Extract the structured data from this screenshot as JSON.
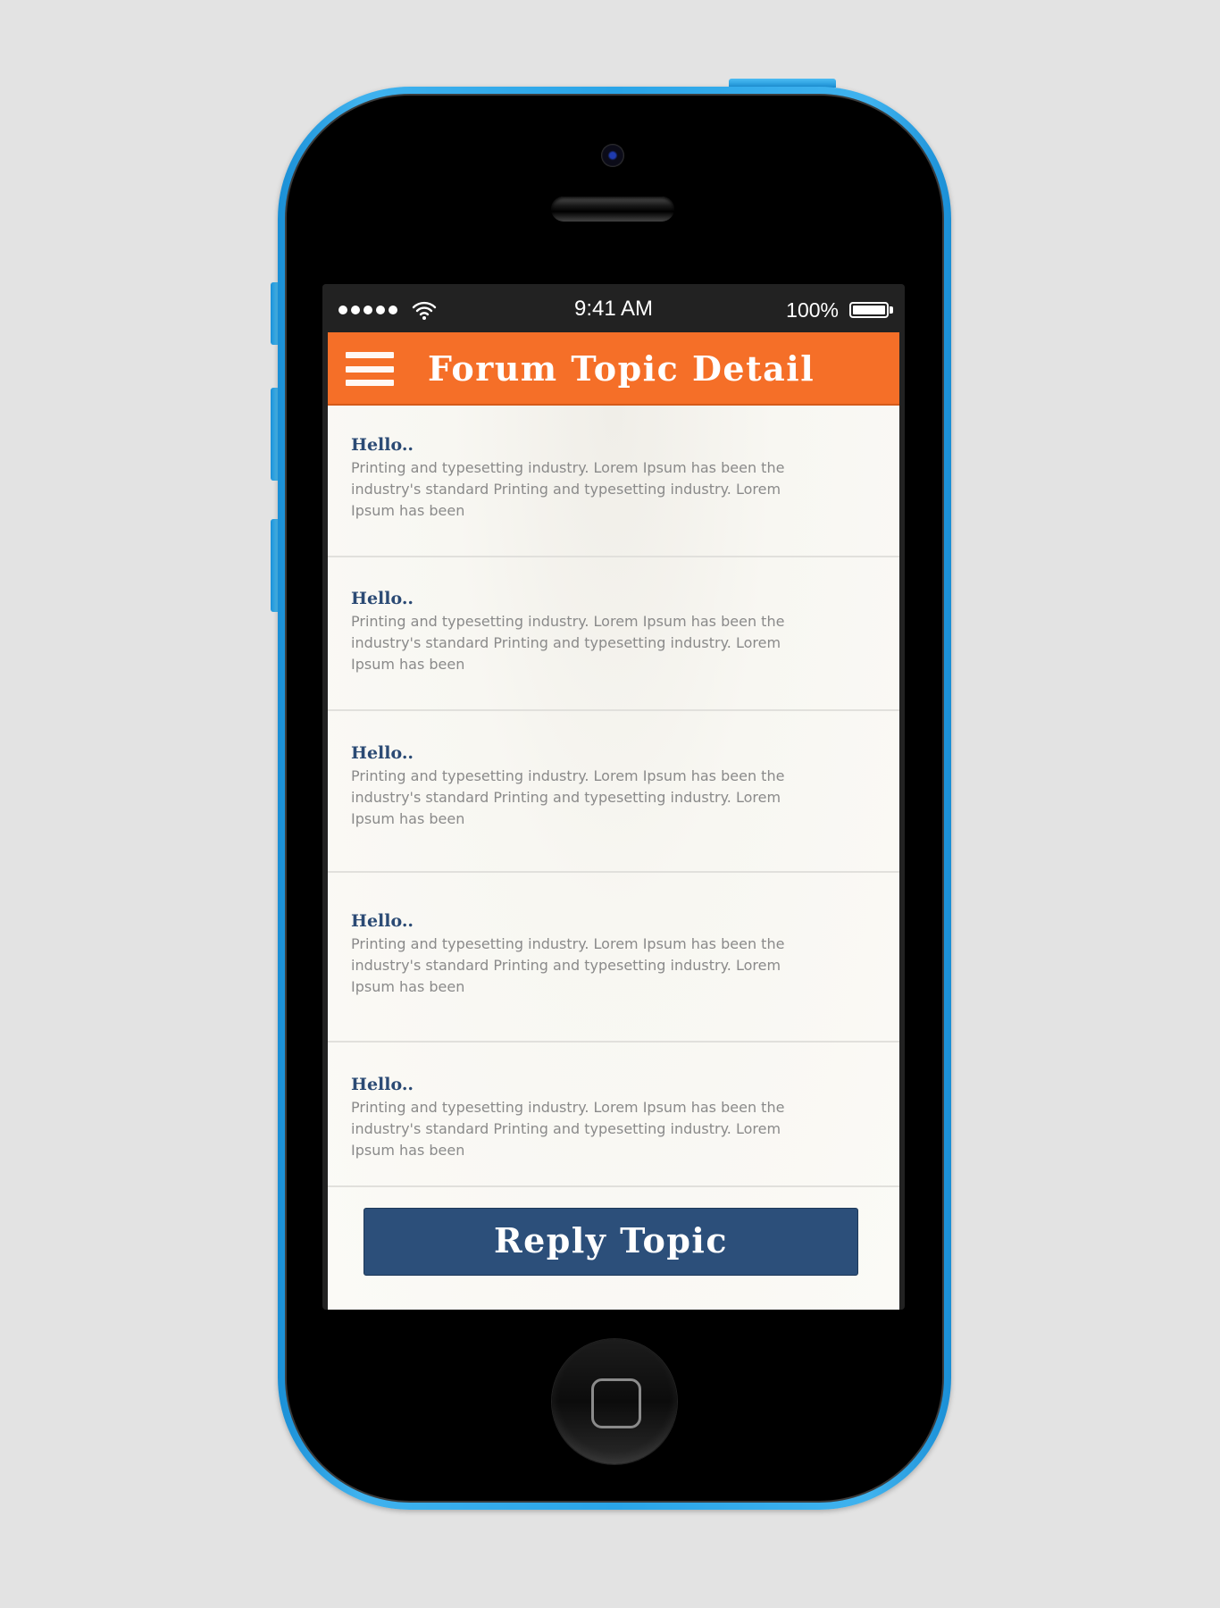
{
  "status_bar": {
    "time": "9:41 AM",
    "battery_percent": "100%",
    "signal_bars": 5,
    "battery_level": 1.0
  },
  "header": {
    "title": "Forum Topic Detail",
    "menu_icon": "hamburger-menu-icon",
    "background_color": "#f56f28"
  },
  "posts": [
    {
      "title": "Hello..",
      "body": "Printing and typesetting industry. Lorem Ipsum has been the industry's standard Printing and typesetting industry. Lorem Ipsum has been"
    },
    {
      "title": "Hello..",
      "body": "Printing and typesetting industry. Lorem Ipsum has been the industry's standard Printing and typesetting industry. Lorem Ipsum has been"
    },
    {
      "title": "Hello..",
      "body": "Printing and typesetting industry. Lorem Ipsum has been the industry's standard Printing and typesetting industry. Lorem Ipsum has been"
    },
    {
      "title": "Hello..",
      "body": "Printing and typesetting industry. Lorem Ipsum has been the industry's standard Printing and typesetting industry. Lorem Ipsum has been"
    },
    {
      "title": "Hello..",
      "body": "Printing and typesetting industry. Lorem Ipsum has been the industry's standard Printing and typesetting industry. Lorem Ipsum has been"
    }
  ],
  "reply_button": {
    "label": "Reply Topic",
    "background_color": "#2c4f7a"
  },
  "device": {
    "color": "#2aa5e8"
  }
}
